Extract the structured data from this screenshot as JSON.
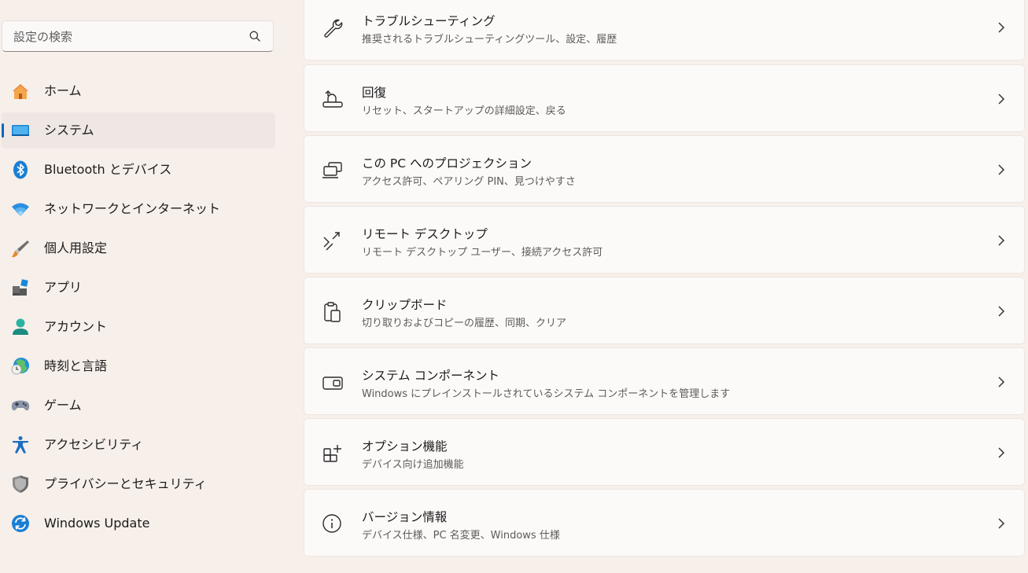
{
  "search": {
    "placeholder": "設定の検索",
    "value": ""
  },
  "sidebar": {
    "items": [
      {
        "label": "ホーム",
        "icon": "home-icon",
        "selected": false
      },
      {
        "label": "システム",
        "icon": "system-icon",
        "selected": true
      },
      {
        "label": "Bluetooth とデバイス",
        "icon": "bluetooth-icon",
        "selected": false
      },
      {
        "label": "ネットワークとインターネット",
        "icon": "wifi-icon",
        "selected": false
      },
      {
        "label": "個人用設定",
        "icon": "brush-icon",
        "selected": false
      },
      {
        "label": "アプリ",
        "icon": "apps-icon",
        "selected": false
      },
      {
        "label": "アカウント",
        "icon": "account-icon",
        "selected": false
      },
      {
        "label": "時刻と言語",
        "icon": "time-language-icon",
        "selected": false
      },
      {
        "label": "ゲーム",
        "icon": "gamepad-icon",
        "selected": false
      },
      {
        "label": "アクセシビリティ",
        "icon": "accessibility-icon",
        "selected": false
      },
      {
        "label": "プライバシーとセキュリティ",
        "icon": "shield-icon",
        "selected": false
      },
      {
        "label": "Windows Update",
        "icon": "windows-update-icon",
        "selected": false
      }
    ]
  },
  "main": {
    "items": [
      {
        "title": "トラブルシューティング",
        "subtitle": "推奨されるトラブルシューティングツール、設定、履歴",
        "icon": "wrench-icon"
      },
      {
        "title": "回復",
        "subtitle": "リセット、スタートアップの詳細設定、戻る",
        "icon": "recovery-icon"
      },
      {
        "title": "この PC へのプロジェクション",
        "subtitle": "アクセス許可、ペアリング PIN、見つけやすさ",
        "icon": "projection-icon"
      },
      {
        "title": "リモート デスクトップ",
        "subtitle": "リモート デスクトップ ユーザー、接続アクセス許可",
        "icon": "remote-desktop-icon"
      },
      {
        "title": "クリップボード",
        "subtitle": "切り取りおよびコピーの履歴、同期、クリア",
        "icon": "clipboard-icon"
      },
      {
        "title": "システム コンポーネント",
        "subtitle": "Windows にプレインストールされているシステム コンポーネントを管理します",
        "icon": "system-components-icon"
      },
      {
        "title": "オプション機能",
        "subtitle": "デバイス向け追加機能",
        "icon": "optional-features-icon"
      },
      {
        "title": "バージョン情報",
        "subtitle": "デバイス仕様、PC 名変更、Windows 仕様",
        "icon": "info-icon"
      }
    ]
  },
  "colors": {
    "background": "#f7efe9",
    "card": "#fcfaf9",
    "accent": "#0067c0",
    "selected_nav": "#efe7e3"
  }
}
